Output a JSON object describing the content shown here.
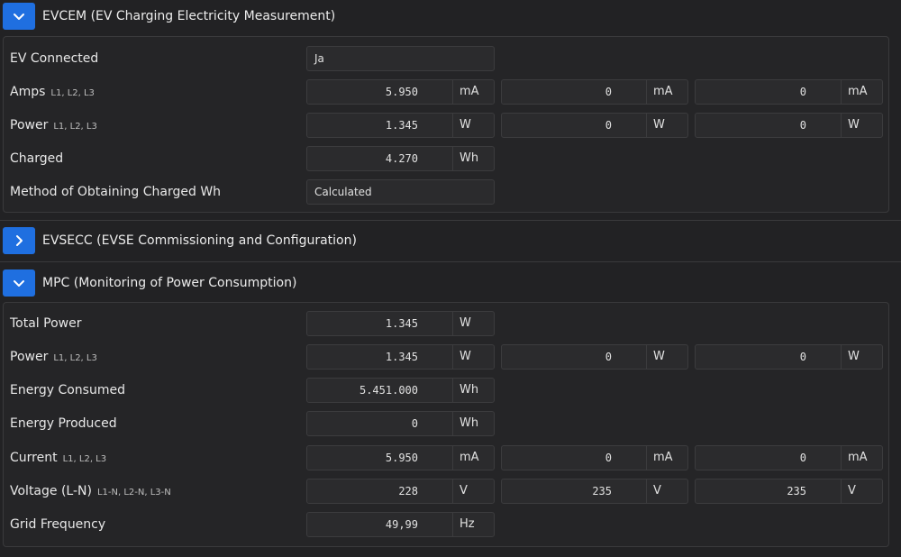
{
  "evcem": {
    "title": "EVCEM (EV Charging Electricity Measurement)",
    "rows": {
      "ev_connected": {
        "label": "EV Connected",
        "value": "Ja"
      },
      "amps": {
        "label": "Amps",
        "sub": "L1, L2, L3",
        "v1": "5.950",
        "v2": "0",
        "v3": "0",
        "unit": "mA"
      },
      "power": {
        "label": "Power",
        "sub": "L1, L2, L3",
        "v1": "1.345",
        "v2": "0",
        "v3": "0",
        "unit": "W"
      },
      "charged": {
        "label": "Charged",
        "value": "4.270",
        "unit": "Wh"
      },
      "method": {
        "label": "Method of Obtaining Charged Wh",
        "value": "Calculated"
      }
    }
  },
  "evsecc": {
    "title": "EVSECC (EVSE Commissioning and Configuration)"
  },
  "mpc": {
    "title": "MPC (Monitoring of Power Consumption)",
    "rows": {
      "total_power": {
        "label": "Total Power",
        "value": "1.345",
        "unit": "W"
      },
      "power": {
        "label": "Power",
        "sub": "L1, L2, L3",
        "v1": "1.345",
        "v2": "0",
        "v3": "0",
        "unit": "W"
      },
      "energy_consumed": {
        "label": "Energy Consumed",
        "value": "5.451.000",
        "unit": "Wh"
      },
      "energy_produced": {
        "label": "Energy Produced",
        "value": "0",
        "unit": "Wh"
      },
      "current": {
        "label": "Current",
        "sub": "L1, L2, L3",
        "v1": "5.950",
        "v2": "0",
        "v3": "0",
        "unit": "mA"
      },
      "voltage": {
        "label": "Voltage (L-N)",
        "sub": "L1-N, L2-N, L3-N",
        "v1": "228",
        "v2": "235",
        "v3": "235",
        "unit": "V"
      },
      "grid_frequency": {
        "label": "Grid Frequency",
        "value": "49,99",
        "unit": "Hz"
      }
    }
  },
  "colors": {
    "accent": "#1f6fe0",
    "background": "#222224",
    "panel": "#252527"
  }
}
